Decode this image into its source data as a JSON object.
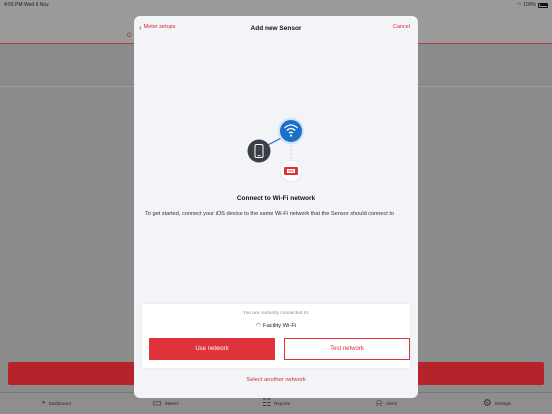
{
  "status_bar": {
    "time_date": "4:55 PM   Wed 6 Nov",
    "battery": "100%"
  },
  "background": {
    "tab_left": "G",
    "tab_right": "t"
  },
  "modal": {
    "back_label": "Meter setups",
    "title": "Add new Sensor",
    "cancel_label": "Cancel",
    "connect_title": "Connect to Wi-Fi network",
    "connect_description": "To get started, connect your iOS device to the same Wi-Fi network that the Sensor should connect to"
  },
  "card": {
    "subtitle": "You are currently connected to:",
    "network_name": "Facility Wi-Fi",
    "use_button": "Use network",
    "test_button": "Test network"
  },
  "select_another": "Select another network",
  "tabbar": {
    "items": [
      {
        "label": "Dashboard",
        "icon": "dashboard-icon"
      },
      {
        "label": "Meters",
        "icon": "meters-icon"
      },
      {
        "label": "Reports",
        "icon": "reports-icon"
      },
      {
        "label": "Alerts",
        "icon": "bell-icon"
      },
      {
        "label": "Settings",
        "icon": "gear-icon"
      }
    ]
  },
  "colors": {
    "accent": "#e0323b",
    "wifi_blue": "#1c6fc6",
    "device_dark": "#3b3f45"
  }
}
